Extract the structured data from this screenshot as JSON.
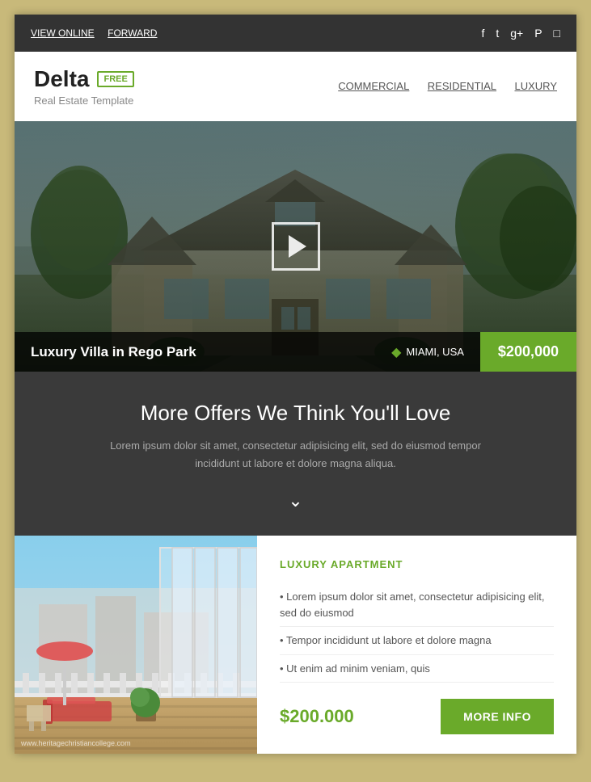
{
  "header": {
    "view_online": "VIEW ONLINE",
    "forward": "FORWARD",
    "social_icons": [
      "f",
      "t",
      "g+",
      "p",
      "cam"
    ]
  },
  "brand": {
    "name": "Delta",
    "badge": "FREE",
    "subtitle": "Real Estate Template",
    "nav": [
      {
        "label": "COMMERCIAL"
      },
      {
        "label": "RESIDENTIAL"
      },
      {
        "label": "LUXURY"
      }
    ]
  },
  "hero": {
    "property_name": "Luxury Villa in Rego Park",
    "location_pin": "📍",
    "location": "MIAMI, USA",
    "price": "$200,000"
  },
  "offers_section": {
    "title": "More Offers We Think You'll Love",
    "description": "Lorem ipsum dolor sit amet, consectetur adipisicing elit, sed do eiusmod tempor incididunt ut labore et dolore magna aliqua."
  },
  "listing": {
    "type": "LUXURY APARTMENT",
    "bullets": [
      "Lorem ipsum dolor sit amet, consectetur adipisicing elit, sed do eiusmod",
      "Tempor incididunt ut labore et dolore magna",
      "Ut enim ad minim veniam, quis"
    ],
    "price": "$200.000",
    "more_info_label": "MORE INFO",
    "watermark": "www.heritagechristiancollege.com"
  }
}
